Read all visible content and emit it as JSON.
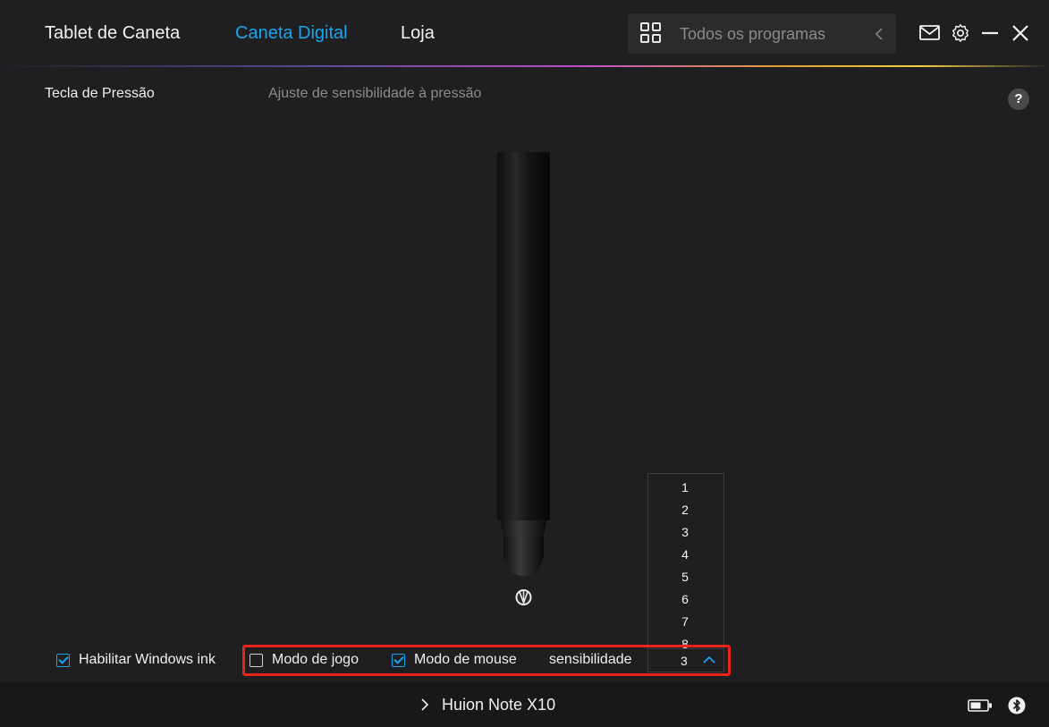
{
  "nav": {
    "tabs": [
      {
        "label": "Tablet de Caneta"
      },
      {
        "label": "Caneta Digital"
      },
      {
        "label": "Loja"
      }
    ],
    "programs_label": "Todos os programas"
  },
  "colors": {
    "accent": "#17a5ee",
    "highlight": "#e8241c",
    "background": "#1f1f21"
  },
  "icons": {
    "programs": "grid-icon",
    "back": "chevron-left-icon",
    "mail": "mail-icon",
    "settings": "gear-icon",
    "minimize": "minimize-icon",
    "close": "close-icon",
    "help": "help-icon",
    "battery": "battery-icon",
    "bluetooth": "bluetooth-icon"
  },
  "section": {
    "title": "Tecla de Pressão",
    "description": "Ajuste de sensibilidade à pressão",
    "help": "?"
  },
  "controls": {
    "windows_ink": {
      "label": "Habilitar Windows ink",
      "checked": true
    },
    "game_mode": {
      "label": "Modo de jogo",
      "checked": false
    },
    "mouse_mode": {
      "label": "Modo de mouse",
      "checked": true
    },
    "sensitivity_label": "sensibilidade",
    "sensitivity_value": "3",
    "sensitivity_options": [
      "1",
      "2",
      "3",
      "4",
      "5",
      "6",
      "7",
      "8"
    ]
  },
  "status": {
    "device_name": "Huion Note X10"
  }
}
